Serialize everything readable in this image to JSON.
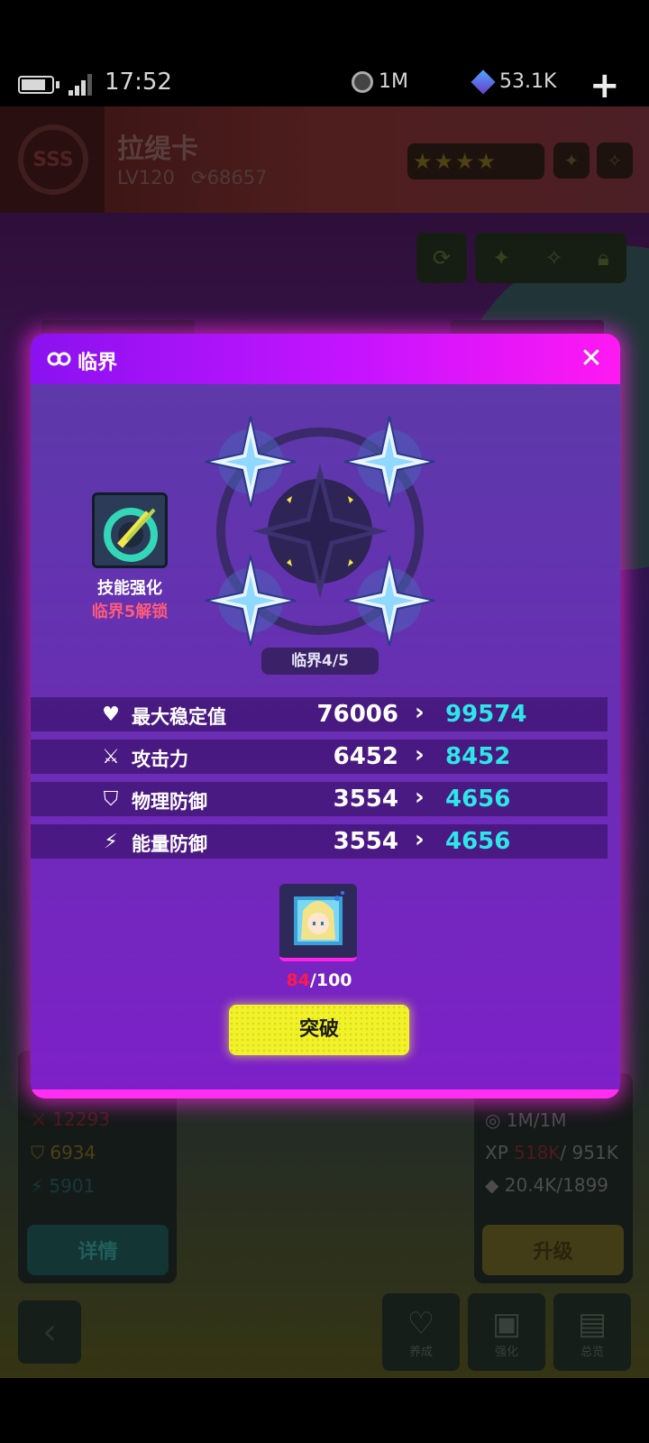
{
  "status_bar": {
    "time": "17:52",
    "coins": "1M",
    "gems": "53.1K"
  },
  "hero": {
    "name": "拉缇卡",
    "level": "LV120",
    "power": "68657"
  },
  "background_panels": {
    "left_stats": [
      "12293",
      "6934",
      "5901"
    ],
    "left_button": "详情",
    "right_stats": [
      "1M/1M",
      "518K",
      "/ 951K",
      "20.4K/1899"
    ],
    "right_button": "升级",
    "nav": [
      "养成",
      "强化",
      "总览"
    ]
  },
  "modal": {
    "title": "临界",
    "skill": {
      "name": "技能强化",
      "unlock": "临界5解锁"
    },
    "tier": "临界4/5",
    "stats": [
      {
        "icon": "heart-pulse-icon",
        "label": "最大稳定值",
        "old": "76006",
        "new": "99574"
      },
      {
        "icon": "sword-icon",
        "label": "攻击力",
        "old": "6452",
        "new": "8452"
      },
      {
        "icon": "shield-exclaim-icon",
        "label": "物理防御",
        "old": "3554",
        "new": "4656"
      },
      {
        "icon": "shield-bolt-icon",
        "label": "能量防御",
        "old": "3554",
        "new": "4656"
      }
    ],
    "material": {
      "have": "84",
      "need": "/100"
    },
    "button": "突破"
  },
  "colors": {
    "accent_cyan": "#2de6e6",
    "header_magenta": "#ff19f2",
    "button_yellow": "#f2f22a",
    "warning_red": "#ff1a4a"
  }
}
